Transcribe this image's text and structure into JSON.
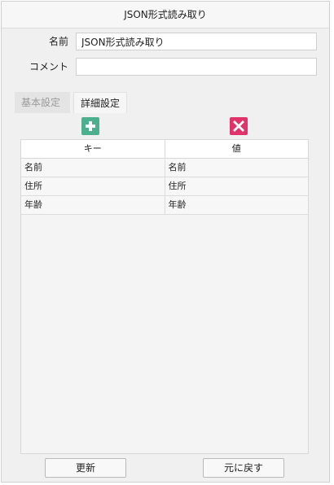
{
  "window": {
    "title": "JSON形式読み取り"
  },
  "form": {
    "name_label": "名前",
    "name_value": "JSON形式読み取り",
    "comment_label": "コメント",
    "comment_value": ""
  },
  "tabs": [
    {
      "label": "基本設定",
      "active": false
    },
    {
      "label": "詳細設定",
      "active": true
    }
  ],
  "toolbar": {
    "add_icon": "plus-icon",
    "delete_icon": "close-icon"
  },
  "table": {
    "columns": [
      "キー",
      "値"
    ],
    "rows": [
      {
        "key": "名前",
        "value": "名前"
      },
      {
        "key": "住所",
        "value": "住所"
      },
      {
        "key": "年齢",
        "value": "年齢"
      }
    ]
  },
  "buttons": {
    "update": "更新",
    "revert": "元に戻す"
  },
  "colors": {
    "add": "#4caf8e",
    "delete": "#e0336c"
  }
}
